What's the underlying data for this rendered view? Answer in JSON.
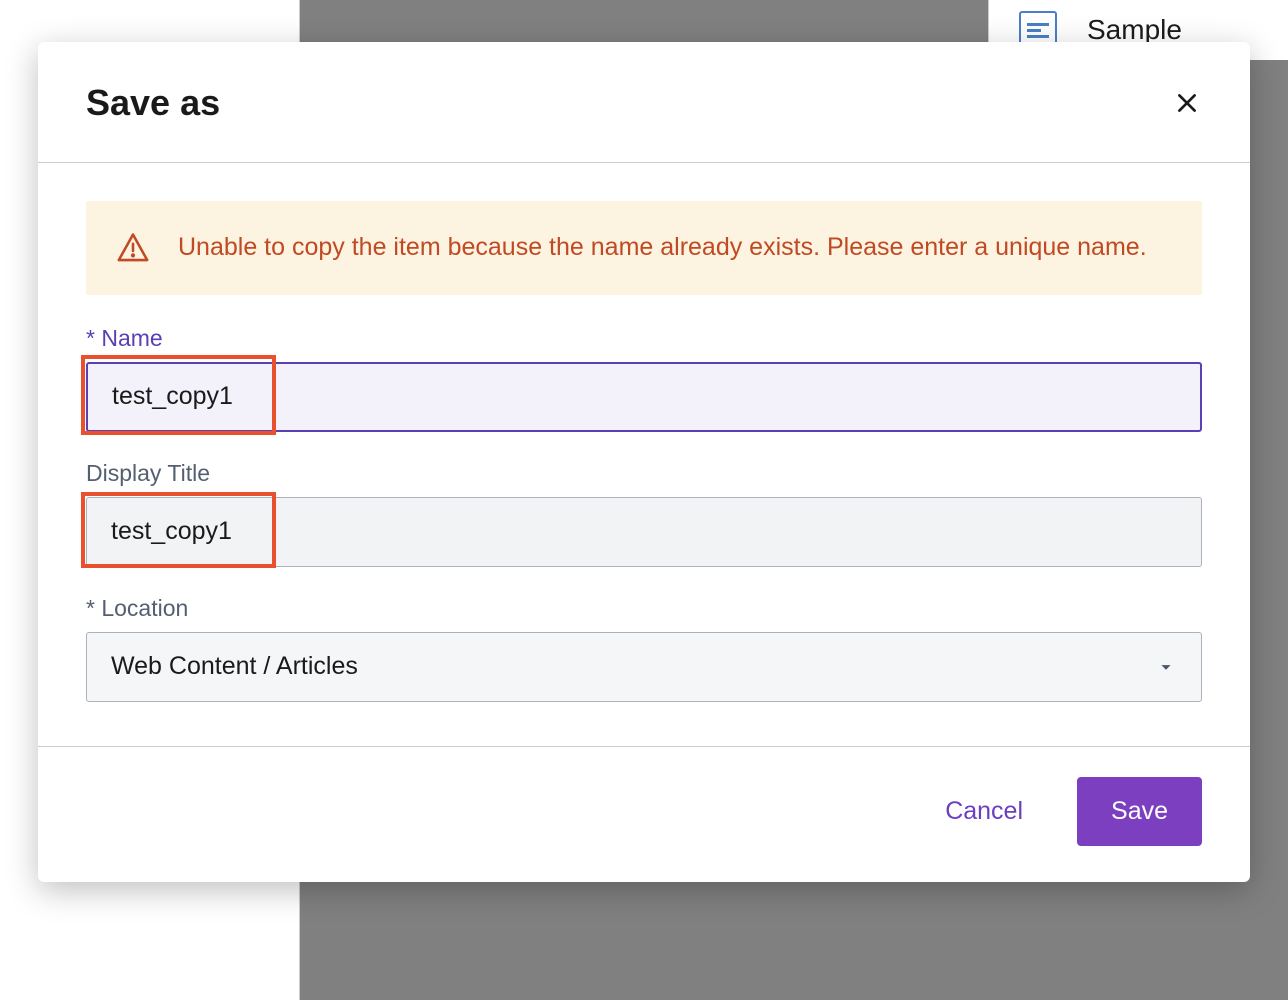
{
  "background": {
    "sample_label": "Sample"
  },
  "modal": {
    "title": "Save as",
    "alert": {
      "message": "Unable to copy the item because the name already exists. Please enter a unique name."
    },
    "fields": {
      "name": {
        "label": "Name",
        "value": "test_copy1"
      },
      "display_title": {
        "label": "Display Title",
        "value": "test_copy1"
      },
      "location": {
        "label": "Location",
        "value": "Web Content / Articles"
      }
    },
    "footer": {
      "cancel_label": "Cancel",
      "save_label": "Save"
    }
  }
}
